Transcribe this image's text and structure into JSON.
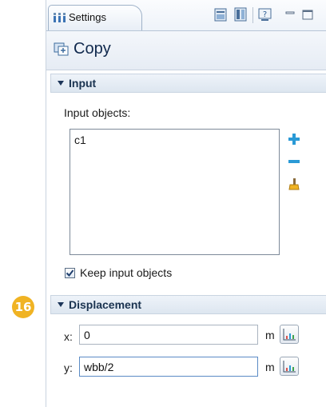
{
  "tab": {
    "label": "Settings",
    "icon": "settings-tab-icon"
  },
  "toolbar": {
    "buttons": [
      "build-selected-icon",
      "build-all-icon",
      "help-icon",
      "minimize-icon",
      "maximize-icon"
    ]
  },
  "header": {
    "title": "Copy",
    "icon": "copy-icon"
  },
  "input_section": {
    "label": "Input",
    "objects_label": "Input objects:",
    "objects": [
      "c1"
    ],
    "keep_label": "Keep input objects",
    "keep_checked": true,
    "side_buttons": [
      "add-icon",
      "remove-icon",
      "clear-selection-icon"
    ]
  },
  "displacement_section": {
    "label": "Displacement",
    "x_label": "x:",
    "x_value": "0",
    "x_unit": "m",
    "y_label": "y:",
    "y_value": "wbb/2",
    "y_unit": "m"
  },
  "badge": {
    "text": "16",
    "color": "#f0b323"
  }
}
